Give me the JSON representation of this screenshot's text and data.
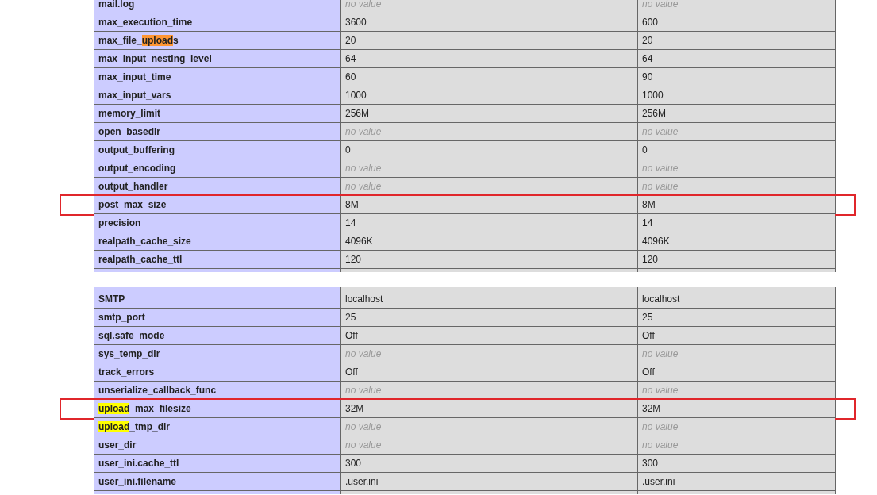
{
  "tables": [
    {
      "rows": [
        {
          "name_parts": [
            {
              "text": "mail.log"
            }
          ],
          "local": {
            "text": "no value",
            "kind": "none"
          },
          "master": {
            "text": "no value",
            "kind": "none"
          },
          "marked": false
        },
        {
          "name_parts": [
            {
              "text": "max_execution_time"
            }
          ],
          "local": {
            "text": "3600",
            "kind": "set"
          },
          "master": {
            "text": "600",
            "kind": "set"
          },
          "marked": false
        },
        {
          "name_parts": [
            {
              "text": "max_file_"
            },
            {
              "text": "upload",
              "color": "#ff9632"
            },
            {
              "text": "s"
            }
          ],
          "local": {
            "text": "20",
            "kind": "set"
          },
          "master": {
            "text": "20",
            "kind": "set"
          },
          "marked": false
        },
        {
          "name_parts": [
            {
              "text": "max_input_nesting_level"
            }
          ],
          "local": {
            "text": "64",
            "kind": "set"
          },
          "master": {
            "text": "64",
            "kind": "set"
          },
          "marked": false
        },
        {
          "name_parts": [
            {
              "text": "max_input_time"
            }
          ],
          "local": {
            "text": "60",
            "kind": "set"
          },
          "master": {
            "text": "90",
            "kind": "set"
          },
          "marked": false
        },
        {
          "name_parts": [
            {
              "text": "max_input_vars"
            }
          ],
          "local": {
            "text": "1000",
            "kind": "set"
          },
          "master": {
            "text": "1000",
            "kind": "set"
          },
          "marked": false
        },
        {
          "name_parts": [
            {
              "text": "memory_limit"
            }
          ],
          "local": {
            "text": "256M",
            "kind": "set"
          },
          "master": {
            "text": "256M",
            "kind": "set"
          },
          "marked": false
        },
        {
          "name_parts": [
            {
              "text": "open_basedir"
            }
          ],
          "local": {
            "text": "no value",
            "kind": "none"
          },
          "master": {
            "text": "no value",
            "kind": "none"
          },
          "marked": false
        },
        {
          "name_parts": [
            {
              "text": "output_buffering"
            }
          ],
          "local": {
            "text": "0",
            "kind": "set"
          },
          "master": {
            "text": "0",
            "kind": "set"
          },
          "marked": false
        },
        {
          "name_parts": [
            {
              "text": "output_encoding"
            }
          ],
          "local": {
            "text": "no value",
            "kind": "none"
          },
          "master": {
            "text": "no value",
            "kind": "none"
          },
          "marked": false
        },
        {
          "name_parts": [
            {
              "text": "output_handler"
            }
          ],
          "local": {
            "text": "no value",
            "kind": "none"
          },
          "master": {
            "text": "no value",
            "kind": "none"
          },
          "marked": false
        },
        {
          "name_parts": [
            {
              "text": "post_max_size"
            }
          ],
          "local": {
            "text": "8M",
            "kind": "set"
          },
          "master": {
            "text": "8M",
            "kind": "set"
          },
          "marked": true
        },
        {
          "name_parts": [
            {
              "text": "precision"
            }
          ],
          "local": {
            "text": "14",
            "kind": "set"
          },
          "master": {
            "text": "14",
            "kind": "set"
          },
          "marked": false
        },
        {
          "name_parts": [
            {
              "text": "realpath_cache_size"
            }
          ],
          "local": {
            "text": "4096K",
            "kind": "set"
          },
          "master": {
            "text": "4096K",
            "kind": "set"
          },
          "marked": false
        },
        {
          "name_parts": [
            {
              "text": "realpath_cache_ttl"
            }
          ],
          "local": {
            "text": "120",
            "kind": "set"
          },
          "master": {
            "text": "120",
            "kind": "set"
          },
          "marked": false
        }
      ]
    },
    {
      "rows": [
        {
          "name_parts": [
            {
              "text": "SMTP"
            }
          ],
          "local": {
            "text": "localhost",
            "kind": "set"
          },
          "master": {
            "text": "localhost",
            "kind": "set"
          },
          "marked": false
        },
        {
          "name_parts": [
            {
              "text": "smtp_port"
            }
          ],
          "local": {
            "text": "25",
            "kind": "set"
          },
          "master": {
            "text": "25",
            "kind": "set"
          },
          "marked": false
        },
        {
          "name_parts": [
            {
              "text": "sql.safe_mode"
            }
          ],
          "local": {
            "text": "Off",
            "kind": "set"
          },
          "master": {
            "text": "Off",
            "kind": "set"
          },
          "marked": false
        },
        {
          "name_parts": [
            {
              "text": "sys_temp_dir"
            }
          ],
          "local": {
            "text": "no value",
            "kind": "none"
          },
          "master": {
            "text": "no value",
            "kind": "none"
          },
          "marked": false
        },
        {
          "name_parts": [
            {
              "text": "track_errors"
            }
          ],
          "local": {
            "text": "Off",
            "kind": "set"
          },
          "master": {
            "text": "Off",
            "kind": "set"
          },
          "marked": false
        },
        {
          "name_parts": [
            {
              "text": "unserialize_callback_func"
            }
          ],
          "local": {
            "text": "no value",
            "kind": "none"
          },
          "master": {
            "text": "no value",
            "kind": "none"
          },
          "marked": false
        },
        {
          "name_parts": [
            {
              "text": "upload",
              "color": "#ffff00"
            },
            {
              "text": "_max_filesize"
            }
          ],
          "local": {
            "text": "32M",
            "kind": "set"
          },
          "master": {
            "text": "32M",
            "kind": "set"
          },
          "marked": true
        },
        {
          "name_parts": [
            {
              "text": "upload",
              "color": "#ffff00"
            },
            {
              "text": "_tmp_dir"
            }
          ],
          "local": {
            "text": "no value",
            "kind": "none"
          },
          "master": {
            "text": "no value",
            "kind": "none"
          },
          "marked": false
        },
        {
          "name_parts": [
            {
              "text": "user_dir"
            }
          ],
          "local": {
            "text": "no value",
            "kind": "none"
          },
          "master": {
            "text": "no value",
            "kind": "none"
          },
          "marked": false
        },
        {
          "name_parts": [
            {
              "text": "user_ini.cache_ttl"
            }
          ],
          "local": {
            "text": "300",
            "kind": "set"
          },
          "master": {
            "text": "300",
            "kind": "set"
          },
          "marked": false
        },
        {
          "name_parts": [
            {
              "text": "user_ini.filename"
            }
          ],
          "local": {
            "text": ".user.ini",
            "kind": "set"
          },
          "master": {
            "text": ".user.ini",
            "kind": "set"
          },
          "marked": false
        }
      ]
    }
  ]
}
